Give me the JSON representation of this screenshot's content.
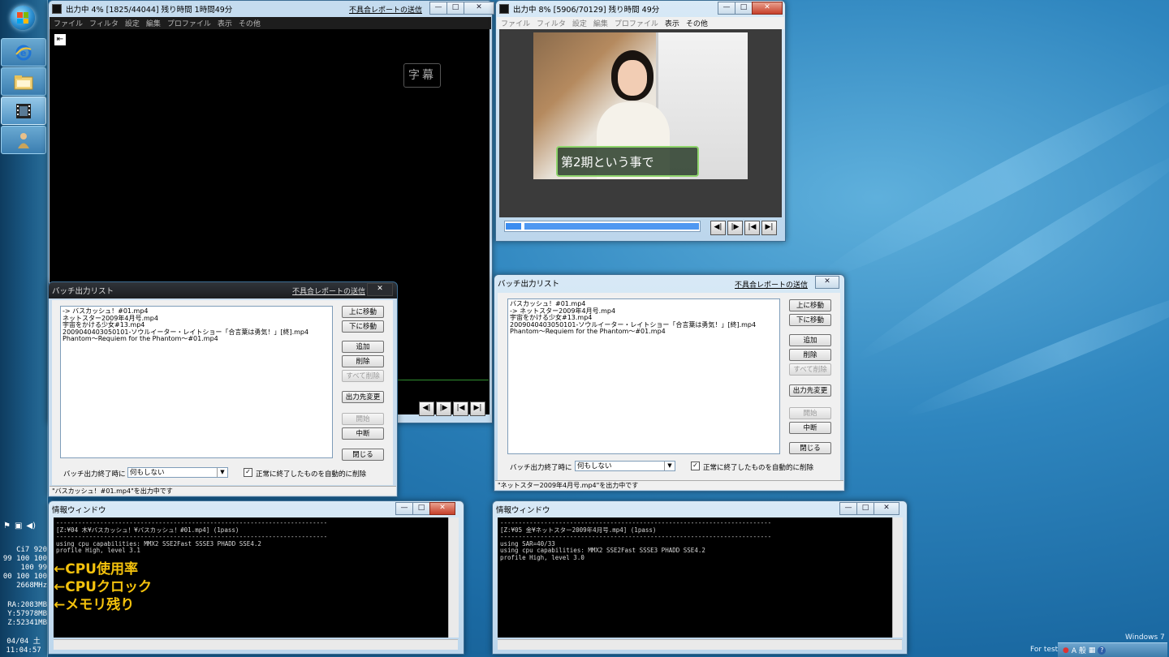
{
  "colors": {
    "desktop": "#2f86bf",
    "annotation": "#f4c20d",
    "progress": "#3c8df0"
  },
  "taskbar": {
    "start_icon": "windows-orb-icon",
    "buttons": [
      {
        "icon": "internet-explorer-icon"
      },
      {
        "icon": "folder-icon"
      },
      {
        "icon": "filmstrip-icon"
      },
      {
        "icon": "person-icon"
      }
    ],
    "tray_icons": [
      "flag-icon",
      "network-icon",
      "speaker-icon"
    ],
    "gadget_cpu": [
      "Ci7 920",
      "99 100 100",
      "100 99",
      "00 100 100",
      "2668MHz"
    ],
    "gadget_mem": [
      "RA:2083MB",
      "Y:57978MB",
      "Z:52341MB"
    ],
    "date": "04/04 土",
    "time": "11:04:57"
  },
  "encoder_left": {
    "title": "出力中 4% [1825/44044]  残り時間 1時間49分",
    "report_link": "不具合レポートの送信",
    "menu": [
      "ファイル",
      "フィルタ",
      "設定",
      "編集",
      "プロファイル",
      "表示",
      "その他"
    ],
    "subtitle_badge": "字幕"
  },
  "encoder_right": {
    "title": "出力中 8% [5906/70129]  残り時間 49分",
    "menu": [
      "ファイル",
      "フィルタ",
      "設定",
      "編集",
      "プロファイル",
      "表示",
      "その他"
    ],
    "video_caption": "第2期という事で",
    "progress": 0.08
  },
  "batch_left": {
    "title": "バッチ出力リスト",
    "report_link": "不具合レポートの送信",
    "items": [
      "-> バスカッシュ！#01.mp4",
      "ネットスター2009年4月号.mp4",
      "宇宙をかける少女#13.mp4",
      "2009040403050101-ソウルイーター・レイトショー「合言葉は勇気！」[終].mp4",
      "Phantom～Requiem for the Phantom～#01.mp4"
    ],
    "buttons": {
      "up": "上に移動",
      "down": "下に移動",
      "add": "追加",
      "delete": "削除",
      "delete_all": "すべて削除",
      "change_dest": "出力先変更",
      "start": "開始",
      "abort": "中断",
      "close": "閉じる"
    },
    "end_label": "バッチ出力終了時に",
    "end_action": "何もしない",
    "auto_delete": "正常に終了したものを自動的に削除",
    "status": "\"バスカッシュ！#01.mp4\"を出力中です"
  },
  "batch_right": {
    "title": "バッチ出力リスト",
    "report_link": "不具合レポートの送信",
    "items": [
      "バスカッシュ！#01.mp4",
      "-> ネットスター2009年4月号.mp4",
      "宇宙をかける少女#13.mp4",
      "2009040403050101-ソウルイーター・レイトショー「合言葉は勇気！」[終].mp4",
      "Phantom～Requiem for the Phantom～#01.mp4"
    ],
    "buttons": {
      "up": "上に移動",
      "down": "下に移動",
      "add": "追加",
      "delete": "削除",
      "delete_all": "すべて削除",
      "change_dest": "出力先変更",
      "start": "開始",
      "abort": "中断",
      "close": "閉じる"
    },
    "end_label": "バッチ出力終了時に",
    "end_action": "何もしない",
    "auto_delete": "正常に終了したものを自動的に削除",
    "status": "\"ネットスター2009年4月号.mp4\"を出力中です"
  },
  "info_left": {
    "title": "情報ウィンドウ",
    "lines": [
      "--------------------------------------------------------------------------",
      "[Z:¥04 木¥バスカッシュ！¥バスカッシュ！#01.mp4] (1pass)",
      "--------------------------------------------------------------------------",
      "using cpu capabilities: MMX2 SSE2Fast SSSE3 PHADD SSE4.2",
      "profile High, level 3.1"
    ]
  },
  "info_right": {
    "title": "情報ウィンドウ",
    "lines": [
      "--------------------------------------------------------------------------",
      "[Z:¥05 金¥ネットスター2009年4月号.mp4] (1pass)",
      "--------------------------------------------------------------------------",
      "using SAR=40/33",
      "using cpu capabilities: MMX2 SSE2Fast SSSE3 PHADD SSE4.2",
      "profile High, level 3.0"
    ]
  },
  "annotations": [
    "←CPU使用率",
    "←CPUクロック",
    "←メモリ残り"
  ],
  "watermark": {
    "os": "Windows 7",
    "build": "For test"
  },
  "systray": {
    "ime": "A 般"
  }
}
